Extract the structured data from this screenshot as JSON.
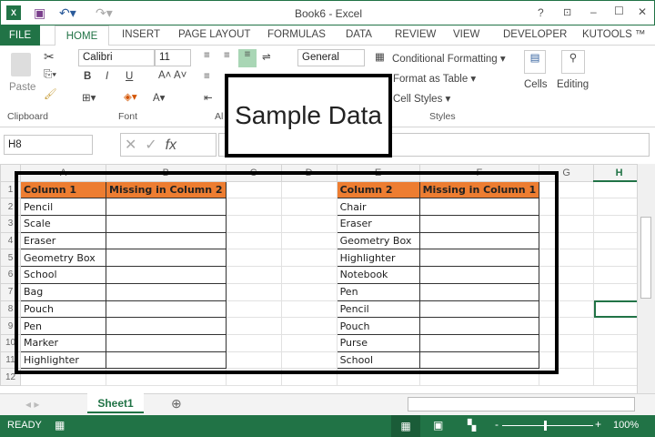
{
  "window": {
    "title": "Book6 - Excel",
    "help": "?",
    "minimize": "–",
    "maximize": "☐",
    "close": "✕"
  },
  "tabs": [
    "FILE",
    "HOME",
    "INSERT",
    "PAGE LAYOUT",
    "FORMULAS",
    "DATA",
    "REVIEW",
    "VIEW",
    "DEVELOPER",
    "KUTOOLS ™"
  ],
  "ribbon": {
    "paste": "Paste",
    "font_name": "Calibri",
    "font_size": "11",
    "number_format": "General",
    "conditional": "Conditional Formatting ▾",
    "format_table": "Format as Table ▾",
    "cell_styles": "Cell Styles ▾",
    "cells": "Cells",
    "editing": "Editing",
    "groups": {
      "clipboard": "Clipboard",
      "font": "Font",
      "alignment": "Al",
      "styles": "Styles"
    },
    "bold": "B",
    "italic": "I",
    "underline": "U"
  },
  "overlay_label": "Sample Data",
  "formula": {
    "name_box": "H8",
    "fx": "fx",
    "value": ""
  },
  "columns": [
    "A",
    "B",
    "C",
    "D",
    "E",
    "F",
    "G",
    "H"
  ],
  "rows": [
    "1",
    "2",
    "3",
    "4",
    "5",
    "6",
    "7",
    "8",
    "9",
    "10",
    "11",
    "12"
  ],
  "left_table": {
    "headers": [
      "Column 1",
      "Missing in Column 2"
    ],
    "values": [
      "Pencil",
      "Scale",
      "Eraser",
      "Geometry Box",
      "School",
      "Bag",
      "Pouch",
      "Pen",
      "Marker",
      "Highlighter"
    ]
  },
  "right_table": {
    "headers": [
      "Column 2",
      "Missing in Column 1"
    ],
    "values": [
      "Chair",
      "Eraser",
      "Geometry Box",
      "Highlighter",
      "Notebook",
      "Pen",
      "Pencil",
      "Pouch",
      "Purse",
      "School"
    ]
  },
  "sheet_tab": "Sheet1",
  "status": {
    "ready": "READY",
    "zoom": "100%"
  },
  "colors": {
    "accent": "#217346",
    "header_fill": "#ed7d31"
  }
}
